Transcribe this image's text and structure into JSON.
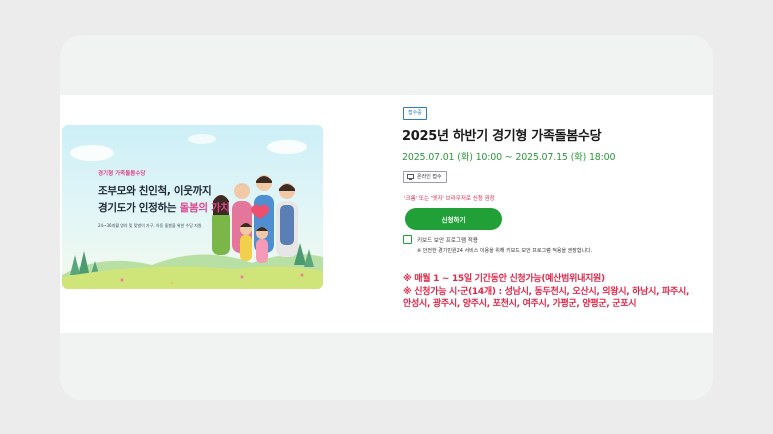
{
  "banner": {
    "tag": "경기형 가족돌봄수당",
    "line1": "조부모와 친인척, 이웃까지",
    "line2_prefix": "경기도가 인정하는 ",
    "line2_highlight": "돌봄의 가치",
    "small": "24~36개월 영아 및 맞벌이 가구, 아동 돌봄을 위한 수당 지원"
  },
  "info": {
    "status_badge": "접수중",
    "title": "2025년 하반기 경기형 가족돌봄수당",
    "period": "2025.07.01 (화) 10:00 ~ 2025.07.15 (화) 18:00",
    "online_label": "온라인 접수",
    "browser_notice": "'크롬' 또는 '엣지' 브라우저로 신청 권장",
    "apply_button": "신청하기",
    "keyboard_security_label": "키보드 보안 프로그램 적용",
    "keyboard_security_note": "※ 안전한 경기민원24 서비스 이용을 위해 키보드 보안 프로그램 적용을 권장합니다.",
    "notes": [
      "※ 매월 1 ~ 15일 기간동안 신청가능(예산범위내지원)",
      "※ 신청가능 시·군(14개) : 성남시, 동두천시, 오산시, 의왕시, 하남시, 파주시,",
      "안성시, 광주시, 양주시, 포천시, 여주시, 가평군, 양평군, 군포시"
    ]
  },
  "colors": {
    "accent_green": "#21a038",
    "alert_red": "#e0284a",
    "badge_blue": "#2a7bbf",
    "banner_pink": "#e0468f"
  }
}
